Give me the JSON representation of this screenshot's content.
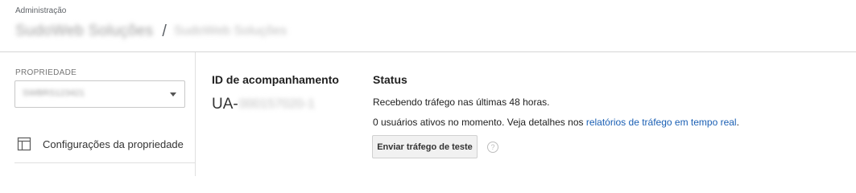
{
  "header": {
    "section_label": "Administração",
    "account_name": "SudoWeb Soluções",
    "separator": "/",
    "property_name": "SudoWeb Soluções"
  },
  "sidebar": {
    "property_label": "PROPRIEDADE",
    "property_select_value": "SWBRS123421",
    "items": [
      {
        "icon": "layout-icon",
        "label": "Configurações da propriedade"
      }
    ]
  },
  "tracking": {
    "title": "ID de acompanhamento",
    "id_prefix": "UA-",
    "id_rest": "000157020-1"
  },
  "status": {
    "title": "Status",
    "line1": "Recebendo tráfego nas últimas 48 horas.",
    "line2_text": "0 usuários ativos no momento. Veja detalhes nos ",
    "line2_link": "relatórios de tráfego em tempo real",
    "line2_end": ".",
    "test_button": "Enviar tráfego de teste",
    "help_icon": "help-circle-icon",
    "help_glyph": "?"
  },
  "colors": {
    "link": "#1a5fb4",
    "divider": "#d6d6d6"
  }
}
